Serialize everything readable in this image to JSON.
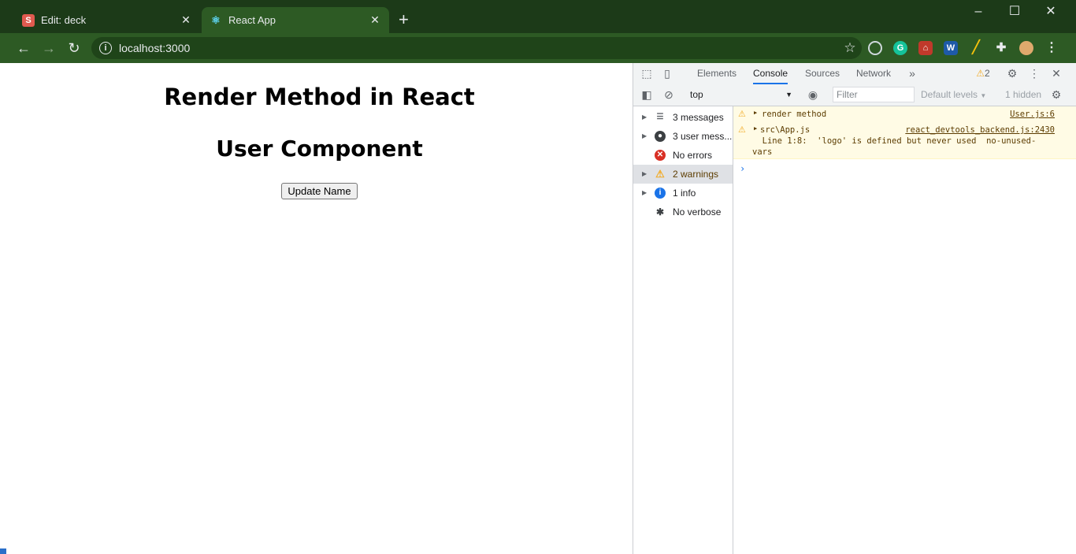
{
  "browser": {
    "tabs": [
      {
        "title": "Edit: deck",
        "favicon": "S",
        "active": false
      },
      {
        "title": "React App",
        "favicon": "react-icon",
        "active": true
      }
    ],
    "url": "localhost:3000"
  },
  "page": {
    "heading": "Render Method in React",
    "subheading": "User Component",
    "button_label": "Update Name"
  },
  "devtools": {
    "tabs": [
      "Elements",
      "Console",
      "Sources",
      "Network"
    ],
    "active_tab": "Console",
    "warning_count": "2",
    "context": "top",
    "filter_placeholder": "Filter",
    "levels": "Default levels",
    "hidden": "1 hidden",
    "sidebar": [
      {
        "label": "3 messages",
        "icon": "list-icon"
      },
      {
        "label": "3 user mess...",
        "icon": "user-icon"
      },
      {
        "label": "No errors",
        "icon": "error-icon"
      },
      {
        "label": "2 warnings",
        "icon": "warning-icon"
      },
      {
        "label": "1 info",
        "icon": "info-icon"
      },
      {
        "label": "No verbose",
        "icon": "bug-icon"
      }
    ],
    "messages": [
      {
        "text": "render method",
        "source": "User.js:6"
      },
      {
        "text": "src\\App.js",
        "source": "react_devtools_backend.js:2430",
        "detail1": "  Line 1:8:  'logo' is defined but never used  no-unused-",
        "detail2": "vars"
      }
    ]
  },
  "colors": {
    "tab_strip": "#1c3a18",
    "toolbar": "#2d5a24",
    "warning_bg": "#fffbe5"
  }
}
